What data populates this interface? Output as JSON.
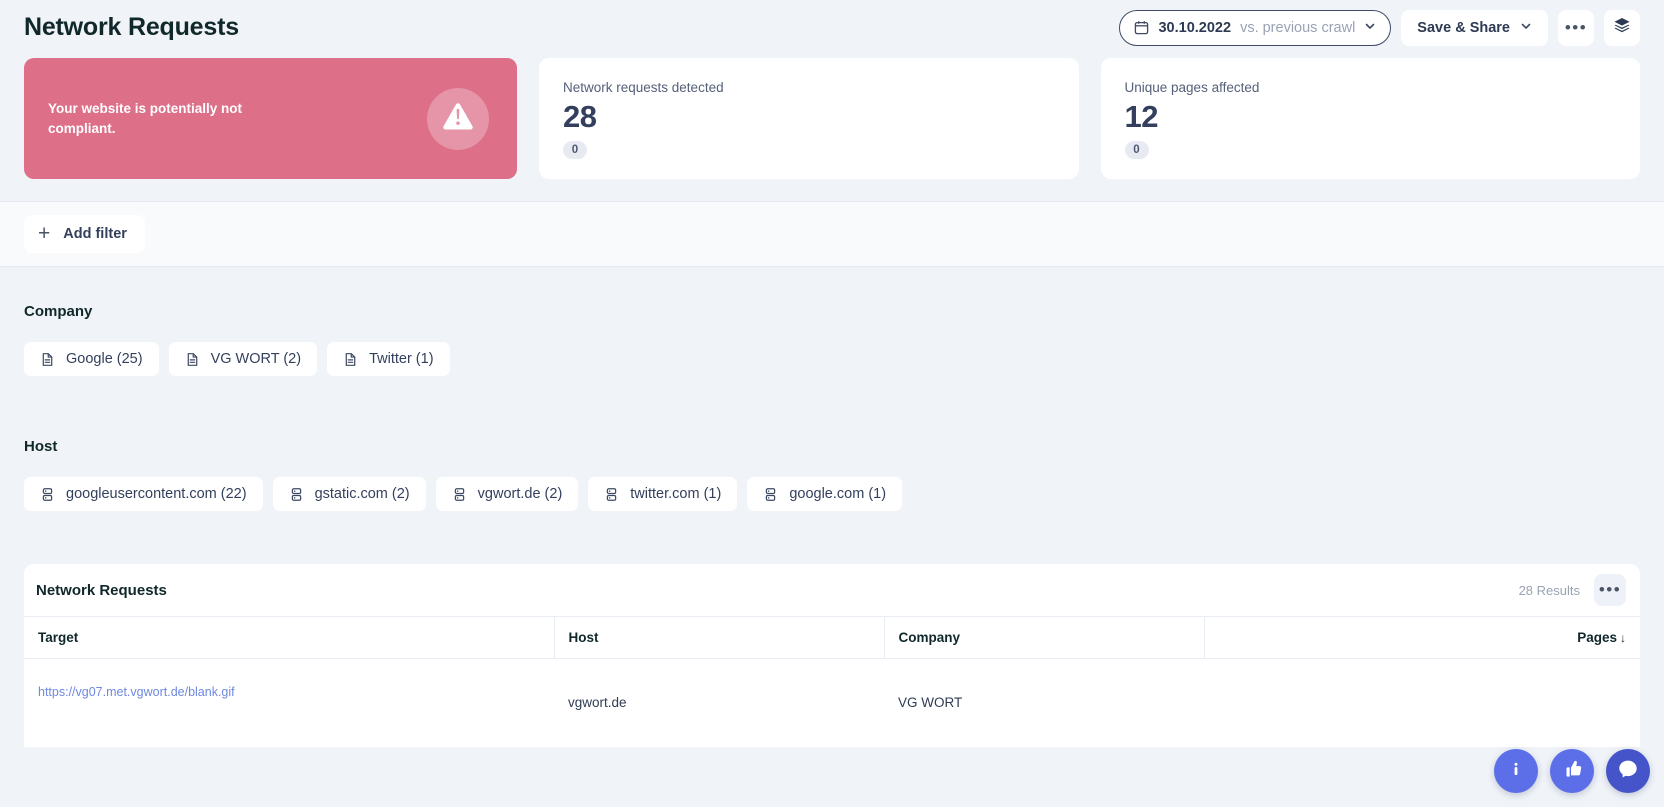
{
  "header": {
    "title": "Network Requests",
    "date_picker": {
      "icon": "calendar-icon",
      "date": "30.10.2022",
      "comparison": "vs. previous crawl",
      "chevron": "chevron-down-icon"
    },
    "save_share_label": "Save & Share",
    "more_label": "•••",
    "layers_icon": "layers-icon"
  },
  "cards": {
    "warning": {
      "text": "Your website is potentially not compliant.",
      "icon": "warning-triangle-icon",
      "color": "#dd6f89"
    },
    "stats": [
      {
        "label": "Network requests detected",
        "value": "28",
        "delta": "0"
      },
      {
        "label": "Unique pages affected",
        "value": "12",
        "delta": "0"
      }
    ]
  },
  "filter_bar": {
    "add_filter_label": "Add filter",
    "plus_icon": "plus-icon"
  },
  "facets": [
    {
      "title": "Company",
      "chip_icon": "document-icon",
      "chips": [
        {
          "label": "Google (25)"
        },
        {
          "label": "VG WORT (2)"
        },
        {
          "label": "Twitter (1)"
        }
      ]
    },
    {
      "title": "Host",
      "chip_icon": "server-stack-icon",
      "chips": [
        {
          "label": "googleusercontent.com (22)"
        },
        {
          "label": "gstatic.com (2)"
        },
        {
          "label": "vgwort.de (2)"
        },
        {
          "label": "twitter.com (1)"
        },
        {
          "label": "google.com (1)"
        }
      ]
    }
  ],
  "table": {
    "title": "Network Requests",
    "results_label": "28 Results",
    "menu_label": "•••",
    "columns": [
      {
        "label": "Target"
      },
      {
        "label": "Host"
      },
      {
        "label": "Company"
      },
      {
        "label": "Pages",
        "sort": "↓"
      }
    ],
    "rows": [
      {
        "target": "https://vg07.met.vgwort.de/blank.gif",
        "host": "vgwort.de",
        "company": "VG WORT",
        "pages": ""
      }
    ]
  },
  "floating_buttons": [
    {
      "name": "info-button",
      "icon": "info-icon"
    },
    {
      "name": "feedback-button",
      "icon": "thumbs-up-icon"
    },
    {
      "name": "chat-button",
      "icon": "chat-bubble-icon"
    }
  ]
}
